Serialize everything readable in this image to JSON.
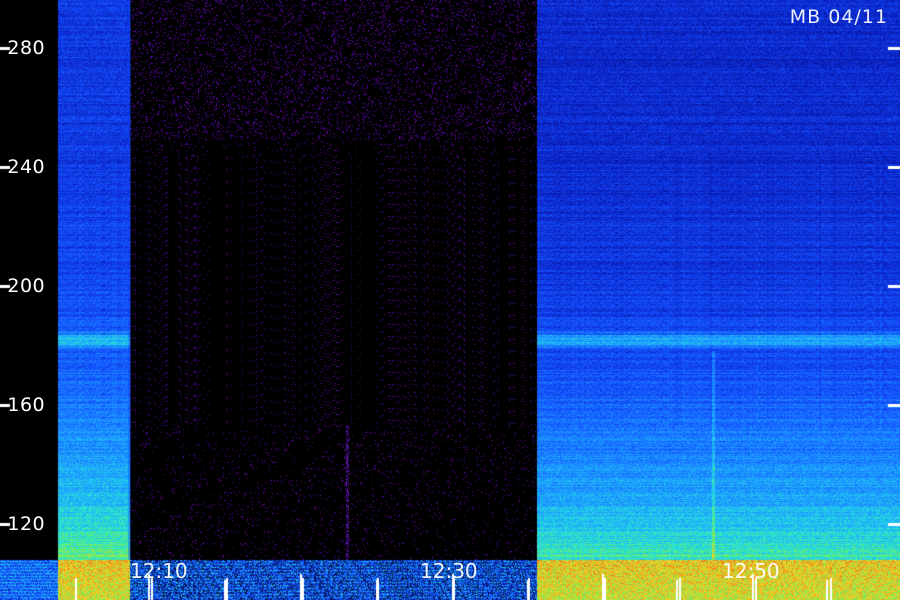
{
  "title": "MB 04/11",
  "chart_data": {
    "type": "heatmap",
    "title": "MB 04/11",
    "xlabel": "",
    "ylabel": "",
    "x_tick_labels": [
      "12:10",
      "12:30",
      "12:50"
    ],
    "y_ticks": [
      120,
      160,
      200,
      240,
      280
    ],
    "y_tick_labels": [
      "-120",
      "-160",
      "-200",
      "-240",
      "-280"
    ],
    "ylim": [
      108,
      296
    ],
    "grid": false,
    "data_gap_between_labels": [
      "12:10",
      "12:30"
    ],
    "band_at": 182,
    "colors": {
      "background": "#000000",
      "low": "#0a1aa0",
      "mid": "#1a6cff",
      "high": "#28e0c0",
      "peak": "#ff8c10"
    }
  }
}
